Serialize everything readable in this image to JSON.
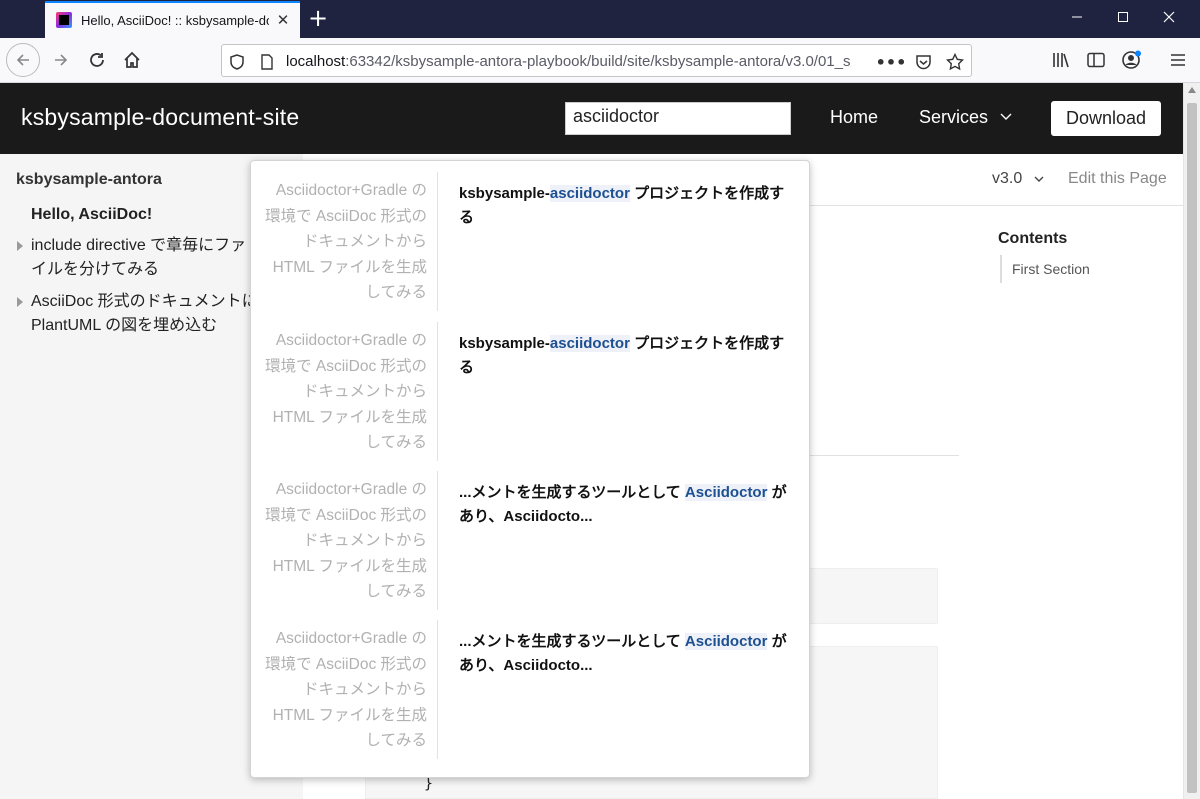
{
  "browser": {
    "tab_title": "Hello, AsciiDoc! :: ksbysample-document-site",
    "url_host": "localhost",
    "url_rest": ":63342/ksbysample-antora-playbook/build/site/ksbysample-antora/v3.0/01_s",
    "colors": {
      "tabstrip": "#202340",
      "accent": "#0a84ff"
    }
  },
  "site": {
    "title": "ksbysample-document-site",
    "search_value": "asciidoctor",
    "nav_home": "Home",
    "nav_services": "Services",
    "download": "Download"
  },
  "sidebar": {
    "component": "ksbysample-antora",
    "items": [
      {
        "label": "Hello, AsciiDoc!"
      },
      {
        "label": "include directive で章毎にファイルを分けてみる"
      },
      {
        "label": "AsciiDoc 形式のドキュメントに PlantUML の図を埋め込む"
      }
    ]
  },
  "toolbar": {
    "version": "v3.0",
    "edit": "Edit this Page"
  },
  "toc": {
    "title": "Contents",
    "items": [
      "First Section"
    ]
  },
  "code": {
    "brace": "}"
  },
  "results": [
    {
      "doc_title": "Asciidoctor+Gradle の環境で AsciiDoc 形式のドキュメントから HTML ファイルを生成してみる",
      "pre": "ksbysample-",
      "match": "asciidoctor",
      "post": " プロジェクトを作成する"
    },
    {
      "doc_title": "Asciidoctor+Gradle の環境で AsciiDoc 形式のドキュメントから HTML ファイルを生成してみる",
      "pre": "ksbysample-",
      "match": "asciidoctor",
      "post": " プロジェクトを作成する"
    },
    {
      "doc_title": "Asciidoctor+Gradle の環境で AsciiDoc 形式のドキュメントから HTML ファイルを生成してみる",
      "pre": "...メントを生成するツールとして ",
      "match": "Asciidoctor",
      "post": " があり、Asciidocto..."
    },
    {
      "doc_title": "Asciidoctor+Gradle の環境で AsciiDoc 形式のドキュメントから HTML ファイルを生成してみる",
      "pre": "...メントを生成するツールとして ",
      "match": "Asciidoctor",
      "post": " があり、Asciidocto..."
    }
  ]
}
